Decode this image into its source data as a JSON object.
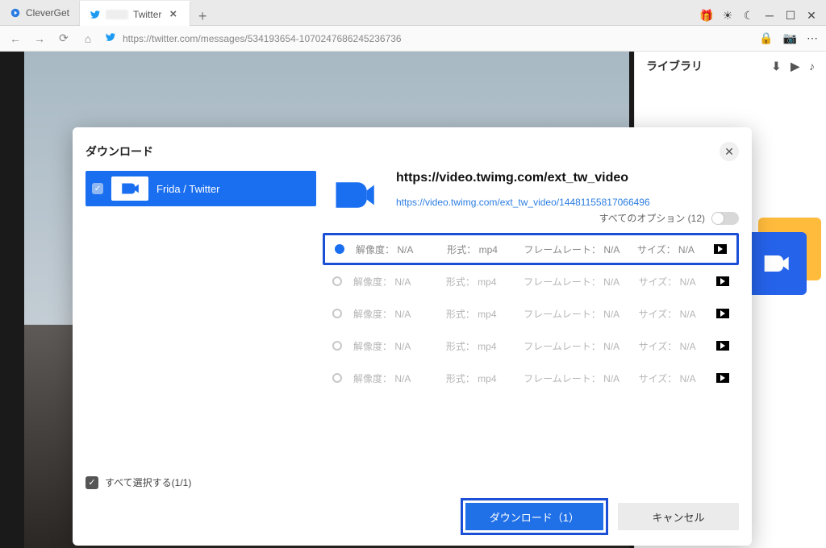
{
  "tabs": {
    "inactive": {
      "label": "CleverGet"
    },
    "active": {
      "label": "Twitter"
    }
  },
  "url": "https://twitter.com/messages/534193654-1070247686245236736",
  "sidebar": {
    "title": "ライブラリ"
  },
  "modal": {
    "title": "ダウンロード",
    "source": {
      "label": "Frida / Twitter"
    },
    "select_all": "すべて選択する(1/1)",
    "url_bold": "https://video.twimg.com/ext_tw_video",
    "url_link": "https://video.twimg.com/ext_tw_video/14481155817066496",
    "all_options": "すべてのオプション (12)",
    "columns": {
      "resolution_label": "解像度：",
      "format_label": "形式：",
      "framerate_label": "フレームレート：",
      "size_label": "サイズ："
    },
    "rows": [
      {
        "resolution": "N/A",
        "format": "mp4",
        "framerate": "N/A",
        "size": "N/A"
      },
      {
        "resolution": "N/A",
        "format": "mp4",
        "framerate": "N/A",
        "size": "N/A"
      },
      {
        "resolution": "N/A",
        "format": "mp4",
        "framerate": "N/A",
        "size": "N/A"
      },
      {
        "resolution": "N/A",
        "format": "mp4",
        "framerate": "N/A",
        "size": "N/A"
      },
      {
        "resolution": "N/A",
        "format": "mp4",
        "framerate": "N/A",
        "size": "N/A"
      }
    ],
    "download_btn": "ダウンロード（1）",
    "cancel_btn": "キャンセル"
  }
}
